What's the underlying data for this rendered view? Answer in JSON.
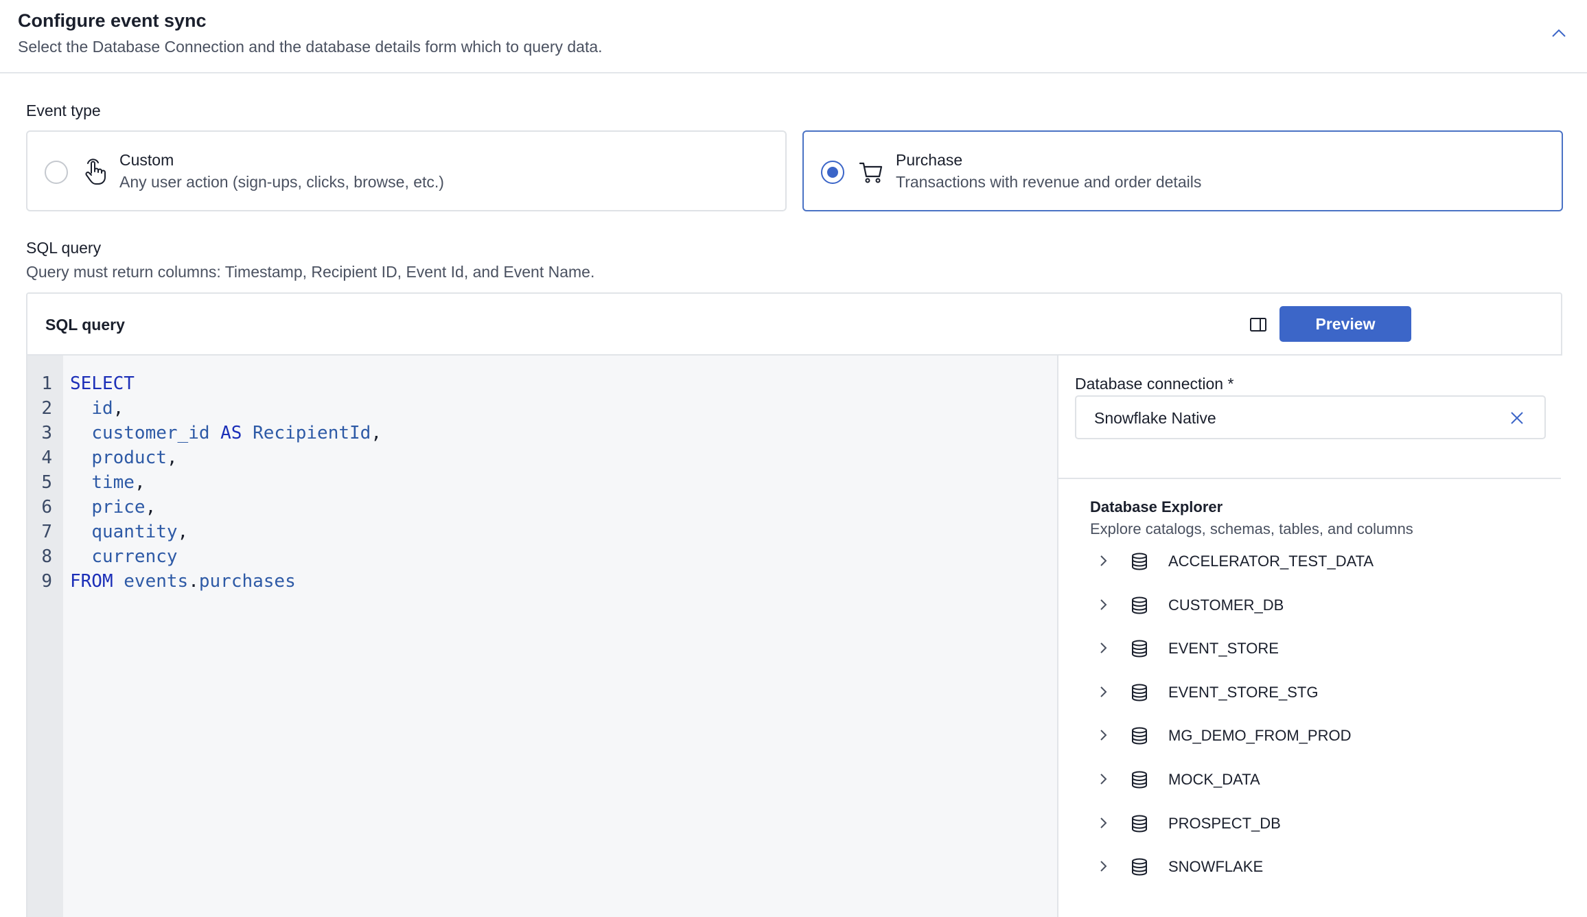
{
  "header": {
    "title": "Configure event sync",
    "subtitle": "Select the Database Connection and the database details form which to query data."
  },
  "event_type": {
    "label": "Event type",
    "options": [
      {
        "title": "Custom",
        "description": "Any user action (sign-ups, clicks, browse, etc.)",
        "icon": "hand-pointer-icon",
        "selected": false
      },
      {
        "title": "Purchase",
        "description": "Transactions with revenue and order details",
        "icon": "shopping-cart-icon",
        "selected": true
      }
    ]
  },
  "sql_section": {
    "label": "SQL query",
    "hint": "Query must return columns: Timestamp, Recipient ID, Event Id, and Event Name."
  },
  "editor": {
    "title": "SQL query",
    "preview_label": "Preview",
    "toolbar_icons": [
      "split-panel-icon",
      "palette-icon",
      "copy-icon"
    ],
    "line_numbers": [
      "1",
      "2",
      "3",
      "4",
      "5",
      "6",
      "7",
      "8",
      "9"
    ],
    "code": [
      [
        {
          "t": "SELECT",
          "c": "kw"
        }
      ],
      [
        {
          "t": "  ",
          "c": ""
        },
        {
          "t": "id",
          "c": "ident"
        },
        {
          "t": ",",
          "c": ""
        }
      ],
      [
        {
          "t": "  ",
          "c": ""
        },
        {
          "t": "customer_id",
          "c": "ident"
        },
        {
          "t": " ",
          "c": ""
        },
        {
          "t": "AS",
          "c": "kw"
        },
        {
          "t": " ",
          "c": ""
        },
        {
          "t": "RecipientId",
          "c": "ident"
        },
        {
          "t": ",",
          "c": ""
        }
      ],
      [
        {
          "t": "  ",
          "c": ""
        },
        {
          "t": "product",
          "c": "ident"
        },
        {
          "t": ",",
          "c": ""
        }
      ],
      [
        {
          "t": "  ",
          "c": ""
        },
        {
          "t": "time",
          "c": "ident"
        },
        {
          "t": ",",
          "c": ""
        }
      ],
      [
        {
          "t": "  ",
          "c": ""
        },
        {
          "t": "price",
          "c": "ident"
        },
        {
          "t": ",",
          "c": ""
        }
      ],
      [
        {
          "t": "  ",
          "c": ""
        },
        {
          "t": "quantity",
          "c": "ident"
        },
        {
          "t": ",",
          "c": ""
        }
      ],
      [
        {
          "t": "  ",
          "c": ""
        },
        {
          "t": "currency",
          "c": "ident"
        }
      ],
      [
        {
          "t": "FROM",
          "c": "kw"
        },
        {
          "t": " ",
          "c": ""
        },
        {
          "t": "events",
          "c": "ident"
        },
        {
          "t": ".",
          "c": ""
        },
        {
          "t": "purchases",
          "c": "ident"
        }
      ]
    ]
  },
  "database": {
    "label": "Database connection *",
    "value": "Snowflake Native"
  },
  "explorer": {
    "title": "Database Explorer",
    "subtitle": "Explore catalogs, schemas, tables, and columns",
    "items": [
      "ACCELERATOR_TEST_DATA",
      "CUSTOMER_DB",
      "EVENT_STORE",
      "EVENT_STORE_STG",
      "MG_DEMO_FROM_PROD",
      "MOCK_DATA",
      "PROSPECT_DB",
      "SNOWFLAKE"
    ]
  },
  "colors": {
    "accent": "#3c66c8",
    "keyword": "#1c2fb8",
    "identifier": "#2e5aa6"
  }
}
